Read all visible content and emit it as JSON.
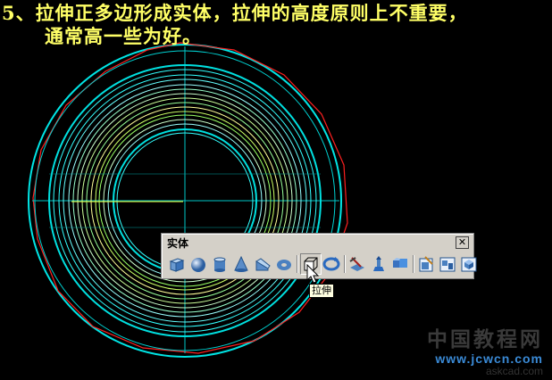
{
  "instruction": {
    "line1": "5、拉伸正多边形成实体，拉伸的高度原则上不重要，",
    "line2": "通常高一些为好。"
  },
  "toolbar": {
    "title": "实体",
    "close_label": "✕",
    "buttons": [
      {
        "name": "box-icon"
      },
      {
        "name": "sphere-icon"
      },
      {
        "name": "cylinder-icon"
      },
      {
        "name": "cone-icon"
      },
      {
        "name": "wedge-icon"
      },
      {
        "name": "torus-icon"
      },
      {
        "name": "extrude-icon"
      },
      {
        "name": "revolve-icon"
      },
      {
        "name": "slice-icon"
      },
      {
        "name": "section-icon"
      },
      {
        "name": "interfere-icon"
      },
      {
        "name": "setup-drawing-icon"
      },
      {
        "name": "setup-view-icon"
      },
      {
        "name": "setup-profile-icon"
      }
    ]
  },
  "tooltip": {
    "text": "拉伸"
  },
  "watermark": {
    "cn": "中国教程网",
    "url": "www.jcwcn.com",
    "ask": "askcad.com"
  },
  "colors": {
    "background": "#000000",
    "cyan": "#00ffff",
    "red": "#ff2020",
    "yellow": "#ffff66",
    "green": "#66ff66"
  }
}
